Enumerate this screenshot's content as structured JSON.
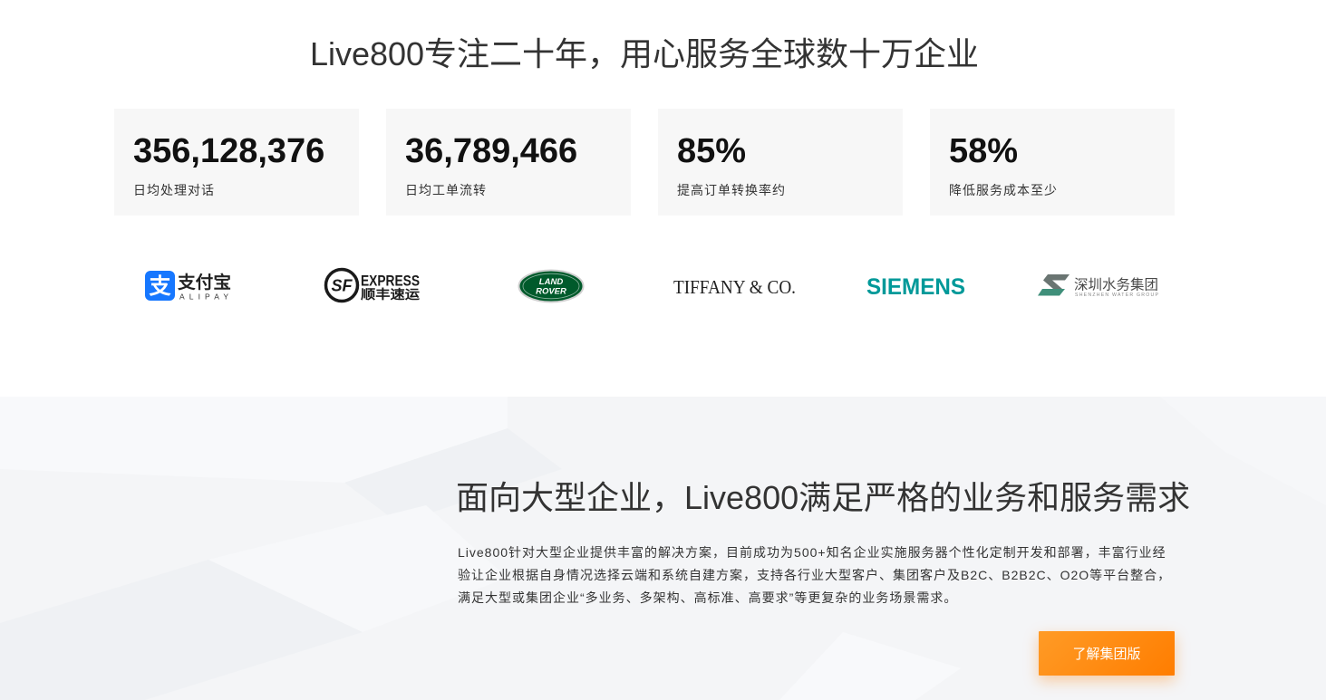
{
  "headline": "Live800专注二十年，用心服务全球数十万企业",
  "stats": [
    {
      "value": "356,128,376",
      "label": "日均处理对话"
    },
    {
      "value": "36,789,466",
      "label": "日均工单流转"
    },
    {
      "value": "85%",
      "label": "提高订单转换率约"
    },
    {
      "value": "58%",
      "label": "降低服务成本至少"
    }
  ],
  "logos": {
    "alipay": {
      "mark": "支",
      "name": "支付宝",
      "sub": "ALIPAY",
      "color": "#1677ff"
    },
    "sf_express": {
      "mark": "SF",
      "name": "EXPRESS",
      "sub": "顺丰速运",
      "color": "#1a1a1a"
    },
    "land_rover": {
      "top": "LAND",
      "bottom": "ROVER",
      "color": "#005a2b"
    },
    "tiffany": {
      "name": "TIFFANY & CO.",
      "color": "#222222"
    },
    "siemens": {
      "name": "SIEMENS",
      "color": "#009999"
    },
    "shenzhen_water": {
      "name": "深圳水务集团",
      "sub": "SHENZHEN WATER GROUP",
      "color": "#3f8f7a"
    }
  },
  "enterprise": {
    "title": "面向大型企业，Live800满足严格的业务和服务需求",
    "description_lines": [
      "Live800针对大型企业提供丰富的解决方案，目前成功为500+知名企业实施服务器个性化定制开发和部署，丰富行业经",
      "验让企业根据自身情况选择云端和系统自建方案，支持各行业大型客户、集团客户及B2C、B2B2C、O2O等平台整合，",
      "满足大型或集团企业“多业务、多架构、高标准、高要求”等更复杂的业务场景需求。"
    ],
    "cta_label": "了解集团版"
  },
  "colors": {
    "text": "#333333",
    "stat_card_bg": "#f7f7f7",
    "section_bg": "#f4f5f7",
    "cta_start": "#ff9b26",
    "cta_end": "#ff7d00",
    "cta_text": "#ffffff"
  }
}
